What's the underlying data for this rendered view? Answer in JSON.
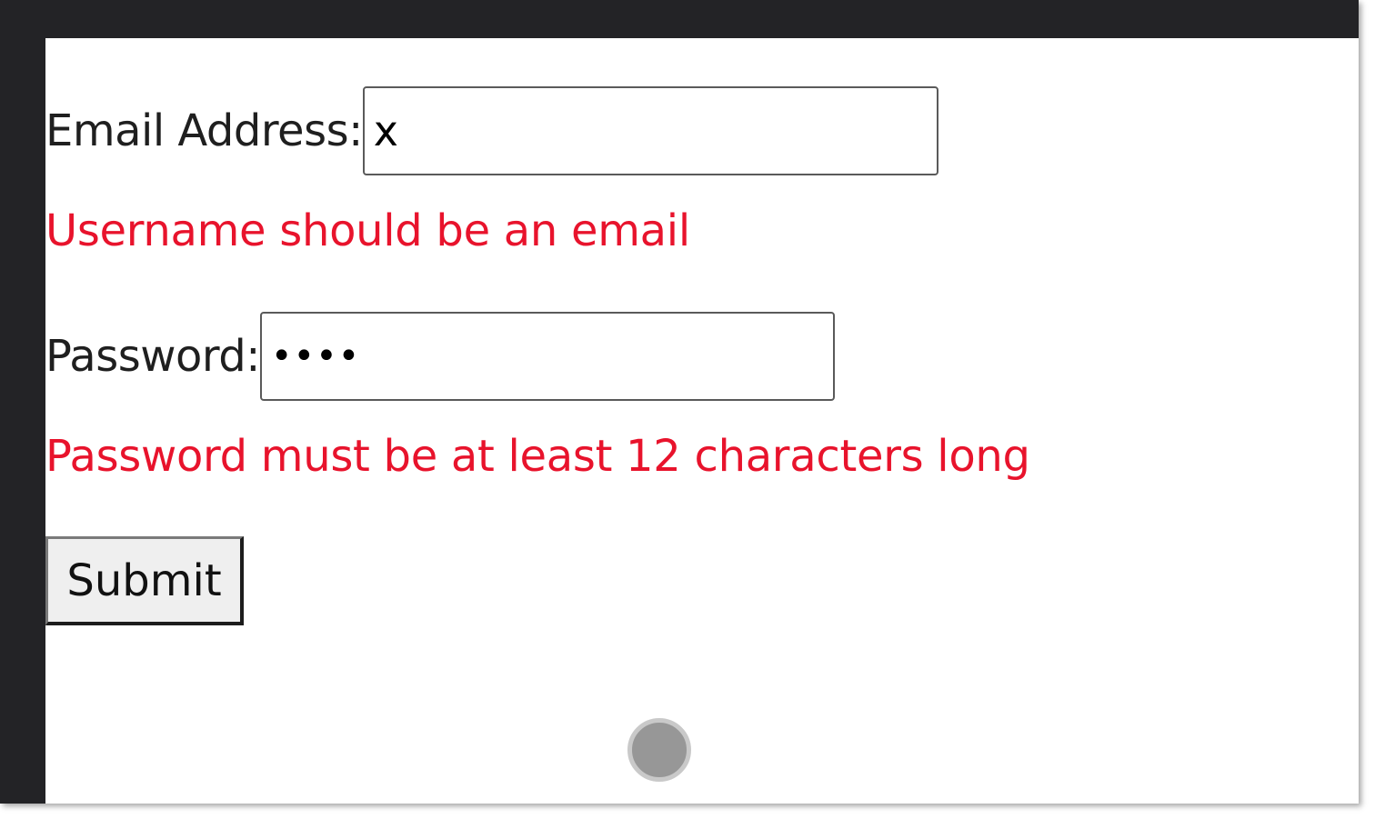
{
  "form": {
    "email_label": "Email Address:",
    "email_value": "x",
    "email_error": "Username should be an email",
    "password_label": "Password:",
    "password_value_masked": "••••",
    "password_error": "Password must be at least 12 characters long",
    "submit_label": "Submit"
  },
  "colors": {
    "error": "#e8132c",
    "frame": "#232326",
    "button_bg": "#efefef"
  },
  "cursor": {
    "icon": "touch-cursor-icon"
  }
}
